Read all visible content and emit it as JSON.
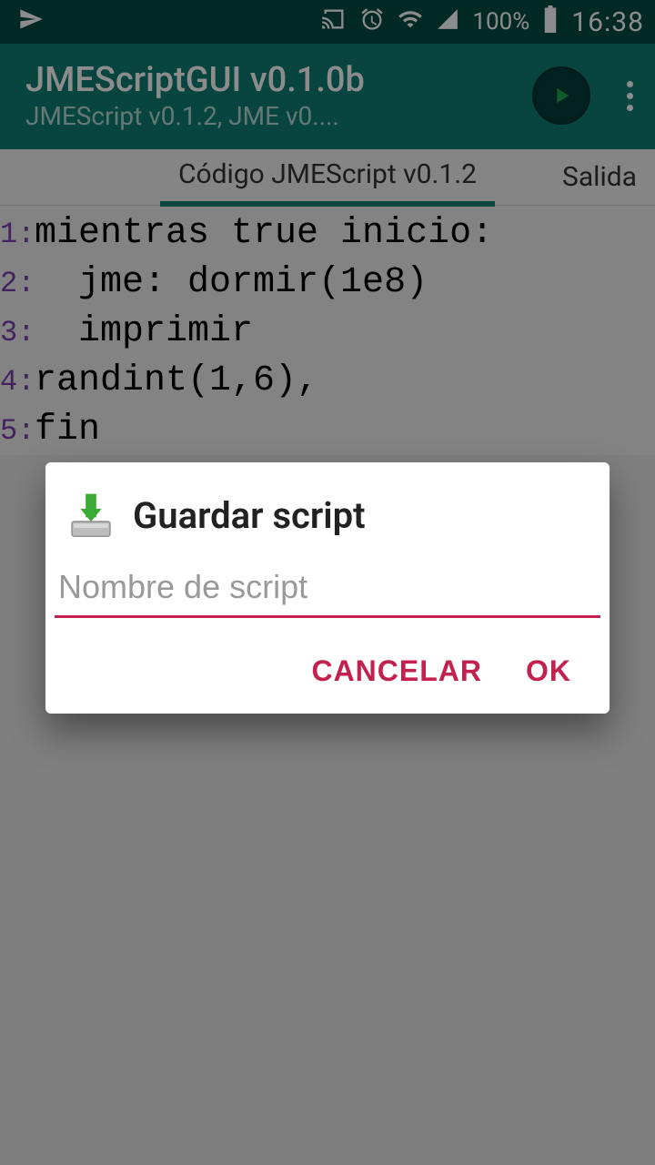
{
  "statusbar": {
    "battery_pct": "100%",
    "time": "16:38"
  },
  "appbar": {
    "title": "JMEScriptGUI v0.1.0b",
    "subtitle": "JMEScript v0.1.2, JME v0...."
  },
  "tabs": {
    "active": "Código JMEScript v0.1.2",
    "side": "Salida"
  },
  "code": {
    "lines": [
      {
        "num": "1:",
        "text": "mientras true inicio:"
      },
      {
        "num": "2:",
        "text": "  jme: dormir(1e8)"
      },
      {
        "num": "3:",
        "text": "  imprimir"
      },
      {
        "num": "4:",
        "text": "randint(1,6),"
      },
      {
        "num": "5:",
        "text": "fin"
      }
    ]
  },
  "dialog": {
    "title": "Guardar script",
    "placeholder": "Nombre de script",
    "cancel": "CANCELAR",
    "ok": "OK"
  }
}
